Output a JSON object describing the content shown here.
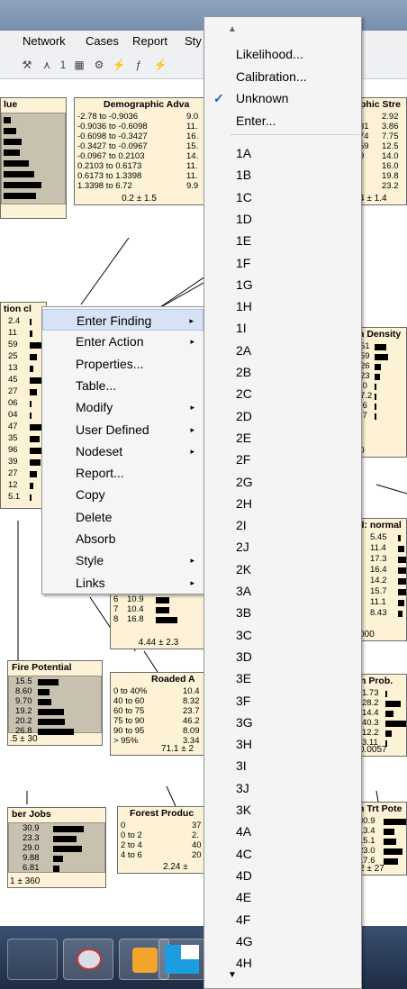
{
  "menubar": {
    "items": [
      "Network",
      "Cases",
      "Report",
      "Sty"
    ],
    "toolbar_text": "1"
  },
  "nodes": {
    "value": {
      "title": "lue"
    },
    "demographic": {
      "title": "Demographic Adva",
      "rows": [
        {
          "label": "-2.78 to -0.9036",
          "value": "9.0"
        },
        {
          "label": "-0.9036 to -0.6098",
          "value": "11."
        },
        {
          "label": "-0.6098 to -0.3427",
          "value": "16."
        },
        {
          "label": "-0.3427 to -0.0967",
          "value": "15."
        },
        {
          "label": "-0.0967 to 0.2103",
          "value": "14."
        },
        {
          "label": "0.2103 to 0.6173",
          "value": "11."
        },
        {
          "label": "0.6173 to 1.3398",
          "value": "11."
        },
        {
          "label": "1.3398 to 6.72",
          "value": "9.9"
        }
      ],
      "footer": "0.2 ± 1.5"
    },
    "graphic_stre": {
      "title": "phic Stre",
      "labels": [
        "",
        "31",
        "74",
        "59",
        "9",
        "",
        "",
        ""
      ],
      "values": [
        "2.92",
        "3.86",
        "7.75",
        "12.5",
        "14.0",
        "16.0",
        "19.8",
        "23.2"
      ],
      "footer": "4 ± 1.4"
    },
    "tion_c": {
      "title": "tion cl",
      "values": [
        "2.4",
        "11",
        "59",
        "25",
        "13",
        "45",
        "27",
        "06",
        "04",
        "47",
        "35",
        "96",
        "39",
        "27",
        "12",
        "5.1"
      ]
    },
    "n_density": {
      "title": "n Density",
      "values": [
        "51",
        "59",
        "26",
        "23",
        ".0",
        "7.2",
        ".6",
        ".7"
      ],
      "footer": "0"
    },
    "d_normal": {
      "title": "d: normal",
      "values": [
        "5.45",
        "11.4",
        "17.3",
        "16.4",
        "14.2",
        "15.7",
        "11.1",
        "8.43"
      ],
      "footer": "000"
    },
    "center": {
      "rows": [
        {
          "label": "6",
          "value": "10.9"
        },
        {
          "label": "7",
          "value": "10.4"
        },
        {
          "label": "8",
          "value": "16.8"
        }
      ],
      "footer": "4.44 ± 2.3"
    },
    "fire_potential": {
      "title": "Fire Potential",
      "values": [
        "15.5",
        "8.60",
        "9.70",
        "19.2",
        "20.2",
        "26.8"
      ],
      "footer": ".5 ± 30"
    },
    "roaded": {
      "title": "Roaded A",
      "rows": [
        {
          "label": "0 to 40%",
          "value": "10.4"
        },
        {
          "label": "40 to 60",
          "value": "8.32"
        },
        {
          "label": "60 to 75",
          "value": "23.7"
        },
        {
          "label": "75 to 90",
          "value": "46.2"
        },
        {
          "label": "90 to 95",
          "value": "8.09"
        },
        {
          "label": "> 95%",
          "value": "3.34"
        }
      ],
      "footer": "71.1 ± 2"
    },
    "n_prob": {
      "title": "n Prob.",
      "values": [
        "1.73",
        "28.2",
        "14.4",
        "40.3",
        "12.2",
        "3.11"
      ],
      "footer": "0.0057"
    },
    "ber_jobs": {
      "title": "ber Jobs",
      "values": [
        "30.9",
        "23.3",
        "29.0",
        "9.88",
        "6.81"
      ],
      "footer": "1 ± 360"
    },
    "forest_product": {
      "title": "Forest Produc",
      "rows": [
        {
          "label": "0",
          "value": "37"
        },
        {
          "label": "0 to 2",
          "value": "2."
        },
        {
          "label": "2 to 4",
          "value": "40"
        },
        {
          "label": "4 to 6",
          "value": "20"
        }
      ],
      "footer": "2.24 ±"
    },
    "n_trt_pote": {
      "title": "n Trt Pote",
      "values": [
        "30.9",
        "13.4",
        "15.1",
        "23.0",
        "17.6"
      ],
      "footer": "2 ± 27"
    }
  },
  "context_menu": {
    "items": [
      {
        "label": "Enter Finding",
        "submenu": true
      },
      {
        "label": "Enter Action",
        "submenu": true
      },
      {
        "label": "Properties...",
        "submenu": false
      },
      {
        "label": "Table...",
        "submenu": false
      },
      {
        "label": "Modify",
        "submenu": true
      },
      {
        "label": "User Defined",
        "submenu": true
      },
      {
        "label": "Nodeset",
        "submenu": true
      },
      {
        "label": "Report...",
        "submenu": false
      },
      {
        "label": "Copy",
        "submenu": false
      },
      {
        "label": "Delete",
        "submenu": false
      },
      {
        "label": "Absorb",
        "submenu": false
      },
      {
        "label": "Style",
        "submenu": true
      },
      {
        "label": "Links",
        "submenu": true
      }
    ],
    "arrow_glyph": "▸"
  },
  "finding_menu": {
    "scroll_up": "▲",
    "scroll_down": "▼",
    "check_glyph": "✓",
    "top_items": [
      "Likelihood...",
      "Calibration...",
      "Unknown",
      "Enter..."
    ],
    "checked_item": "Unknown",
    "states": [
      "1A",
      "1B",
      "1C",
      "1D",
      "1E",
      "1F",
      "1G",
      "1H",
      "1I",
      "2A",
      "2B",
      "2C",
      "2D",
      "2E",
      "2F",
      "2G",
      "2H",
      "2I",
      "2J",
      "2K",
      "3A",
      "3B",
      "3C",
      "3D",
      "3E",
      "3F",
      "3G",
      "3H",
      "3I",
      "3J",
      "3K",
      "4A",
      "4C",
      "4D",
      "4E",
      "4F",
      "4G",
      "4H"
    ]
  }
}
